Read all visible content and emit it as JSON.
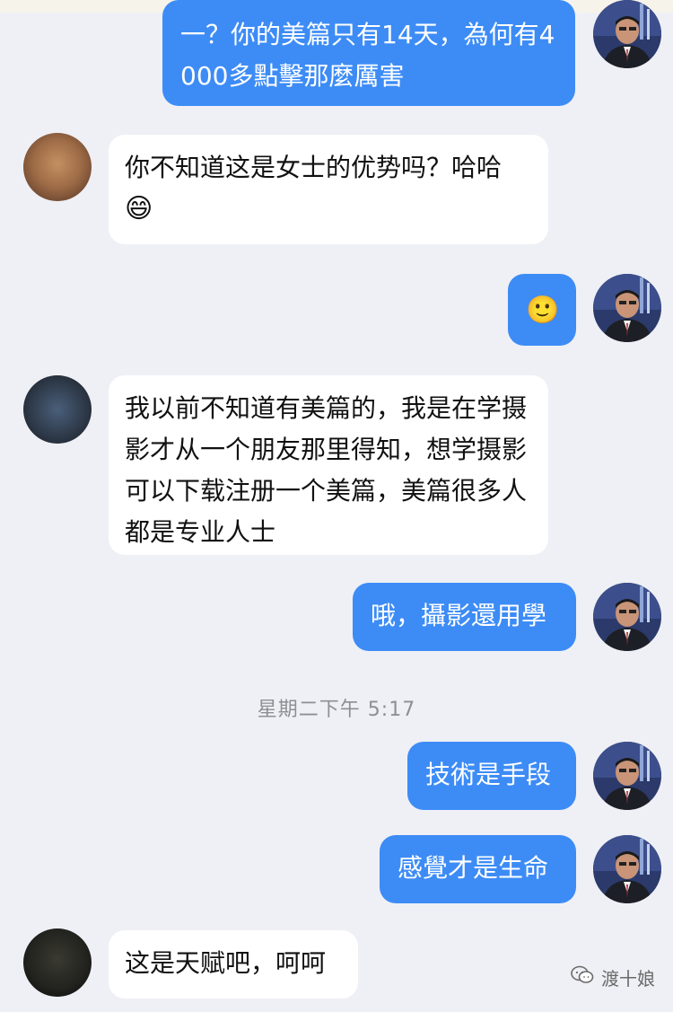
{
  "messages": [
    {
      "from": "self",
      "text": "一？你的美篇只有14天，為何有4000多點擊那麼厲害"
    },
    {
      "from": "other",
      "text": "你不知道这是女士的优势吗？哈哈",
      "emoji": "😄"
    },
    {
      "from": "self",
      "emoji": "🙂"
    },
    {
      "from": "other",
      "text": "我以前不知道有美篇的，我是在学摄影才从一个朋友那里得知，想学摄影可以下载注册一个美篇，美篇很多人都是专业人士"
    },
    {
      "from": "self",
      "text": "哦，攝影還用學"
    },
    {
      "from": "self",
      "text": "技術是手段"
    },
    {
      "from": "self",
      "text": "感覺才是生命"
    },
    {
      "from": "other",
      "text": "这是天赋吧，呵呵"
    }
  ],
  "timestamp": "星期二下午 5:17",
  "watermark": {
    "text": "渡十娘",
    "icon": "wechat-icon"
  },
  "colors": {
    "background": "#eff0f5",
    "outgoing_bubble": "#3d8cf6",
    "incoming_bubble": "#ffffff",
    "timestamp": "#8e8e93"
  },
  "icons": {
    "self_avatar": "man-in-suit-avatar",
    "other_avatar": "blurred-photo-avatar",
    "grin_emoji": "grinning-face-emoji",
    "smile_emoji": "slightly-smiling-face-emoji"
  }
}
